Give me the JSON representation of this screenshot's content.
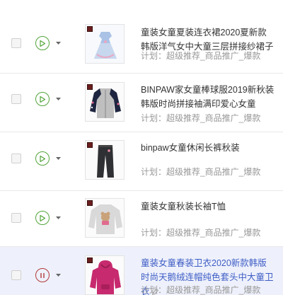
{
  "rows": [
    {
      "title": "童装女童夏装连衣裙2020夏新款韩版洋气女中大童三层拼接纱裙子",
      "plan_label": "计划：超级推荐_商品推广_爆款",
      "status": "running",
      "thumb_icon": "dress-product-image"
    },
    {
      "title": "BINPAW家女童棒球服2019新秋装韩版时尚拼接袖满印爱心女童",
      "plan_label": "计划：超级推荐_商品推广_爆款",
      "status": "running",
      "thumb_icon": "baseball-jacket-product-image"
    },
    {
      "title": "binpaw女童休闲长裤秋装",
      "plan_label": "计划：超级推荐_商品推广_爆款",
      "status": "running",
      "thumb_icon": "pants-product-image"
    },
    {
      "title": "童装女童秋装长袖T恤",
      "plan_label": "计划：超级推荐_商品推广_爆款",
      "status": "running",
      "thumb_icon": "tshirt-product-image"
    },
    {
      "title": "童装女童春装卫衣2020新款韩版时尚天鹅绒连帽纯色套头中大童卫衣",
      "plan_label": "计划：超级推荐_商品推广_爆款",
      "status": "paused",
      "thumb_icon": "hoodie-product-image"
    }
  ],
  "colors": {
    "running": "#52a43a",
    "paused": "#b23a3a",
    "link": "#3d5cc5",
    "active_row_bg": "#eef1fb"
  }
}
